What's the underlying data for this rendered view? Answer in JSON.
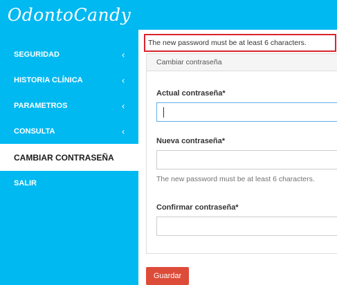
{
  "app": {
    "logo_text": "OdontoCandy"
  },
  "sidebar": {
    "items": [
      {
        "label": "SEGURIDAD",
        "chevron": "‹",
        "active": false
      },
      {
        "label": "HISTORIA CLÍNICA",
        "chevron": "‹",
        "active": false
      },
      {
        "label": "PARAMETROS",
        "chevron": "‹",
        "active": false
      },
      {
        "label": "CONSULTA",
        "chevron": "‹",
        "active": false
      },
      {
        "label": "CAMBIAR CONTRASEÑA",
        "active": true
      },
      {
        "label": "SALIR",
        "active": false
      }
    ]
  },
  "alert": {
    "message": "The new password must be at least 6 characters.",
    "border_color": "#d9232d"
  },
  "panel": {
    "heading": "Cambiar contraseña",
    "current_password": {
      "label": "Actual contraseña*",
      "value": ""
    },
    "new_password": {
      "label": "Nueva contraseña*",
      "value": "",
      "help": "The new password must be at least 6 characters."
    },
    "confirm_password": {
      "label": "Confirmar contraseña*",
      "value": ""
    }
  },
  "actions": {
    "save_label": "Guardar"
  },
  "colors": {
    "brand": "#00b9f1",
    "save_button": "#dd4b39"
  }
}
